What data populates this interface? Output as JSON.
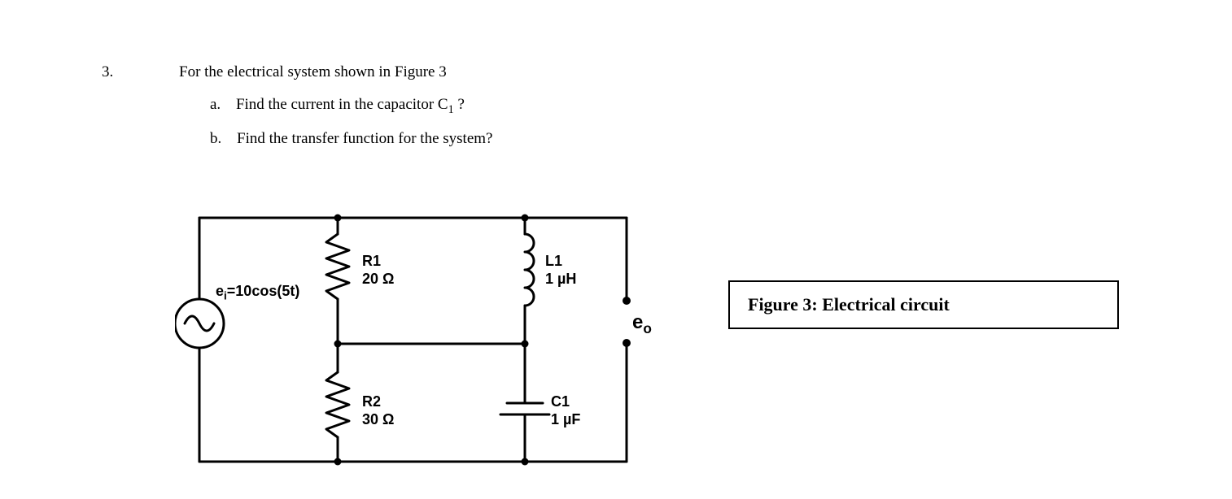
{
  "question": {
    "number": "3.",
    "prompt": "For the electrical system shown in Figure 3",
    "parts": {
      "a": {
        "letter": "a.",
        "text_before": "Find the current in the capacitor C",
        "sub": "1",
        "text_after": " ?"
      },
      "b": {
        "letter": "b.",
        "text": "Find the transfer function for the system?"
      }
    }
  },
  "circuit": {
    "source": {
      "label_prefix": "e",
      "label_sub": "i",
      "label_rest": "=10cos(5t)"
    },
    "components": {
      "R1": {
        "name": "R1",
        "value": "20 Ω"
      },
      "R2": {
        "name": "R2",
        "value": "30 Ω"
      },
      "L1": {
        "name": "L1",
        "value": "1 µH"
      },
      "C1": {
        "name": "C1",
        "value": "1 µF"
      }
    },
    "output": {
      "label_prefix": "e",
      "label_sub": "o"
    }
  },
  "caption": "Figure 3: Electrical circuit"
}
